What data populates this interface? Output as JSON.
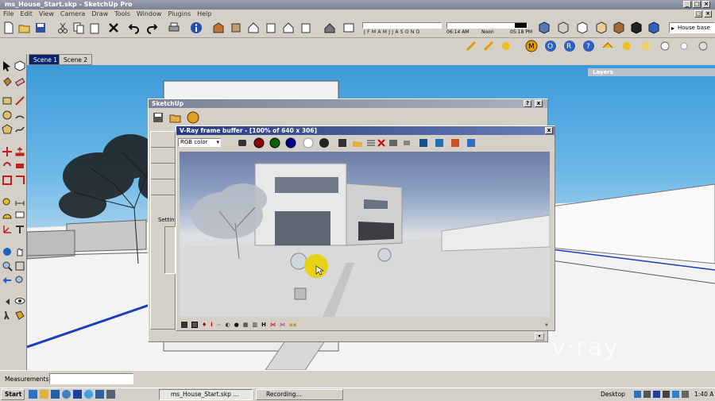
{
  "window": {
    "title": "ms_House_Start.skp - SketchUp Pro"
  },
  "menu": [
    "File",
    "Edit",
    "View",
    "Camera",
    "Draw",
    "Tools",
    "Window",
    "Plugins",
    "Help"
  ],
  "shadow": {
    "months": "J F M A M J J A S O N D",
    "time_start": "06:14 AM",
    "time_noon": "Noon",
    "time_end": "05:18 PM"
  },
  "style_dropdown": {
    "value": "House base"
  },
  "scenes": [
    "Scene 1",
    "Scene 2"
  ],
  "layers_panel": {
    "title": "Layers"
  },
  "sketchup_dialog": {
    "title": "SketchUp",
    "help_btn": "?",
    "close_btn": "x",
    "settings_label": "Settin"
  },
  "vfb": {
    "title": "V-Ray frame buffer - [100% of 640 x 306]",
    "close_btn": "x",
    "channel_select": "RGB color",
    "bottom_letter_i": "i",
    "bottom_letter_h": "H"
  },
  "watermark": {
    "text": "v·ray"
  },
  "status": {
    "measurements_label": "Measurements"
  },
  "taskbar": {
    "start": "Start",
    "item1": "ms_House_Start.skp ...",
    "item2": "Recording...",
    "desktop": "Desktop",
    "clock": "1:40 A"
  },
  "colors": {
    "accent": "#0a246a",
    "vfb_red": "#8b0000",
    "vfb_green": "#006400",
    "vfb_blue": "#00008b"
  }
}
